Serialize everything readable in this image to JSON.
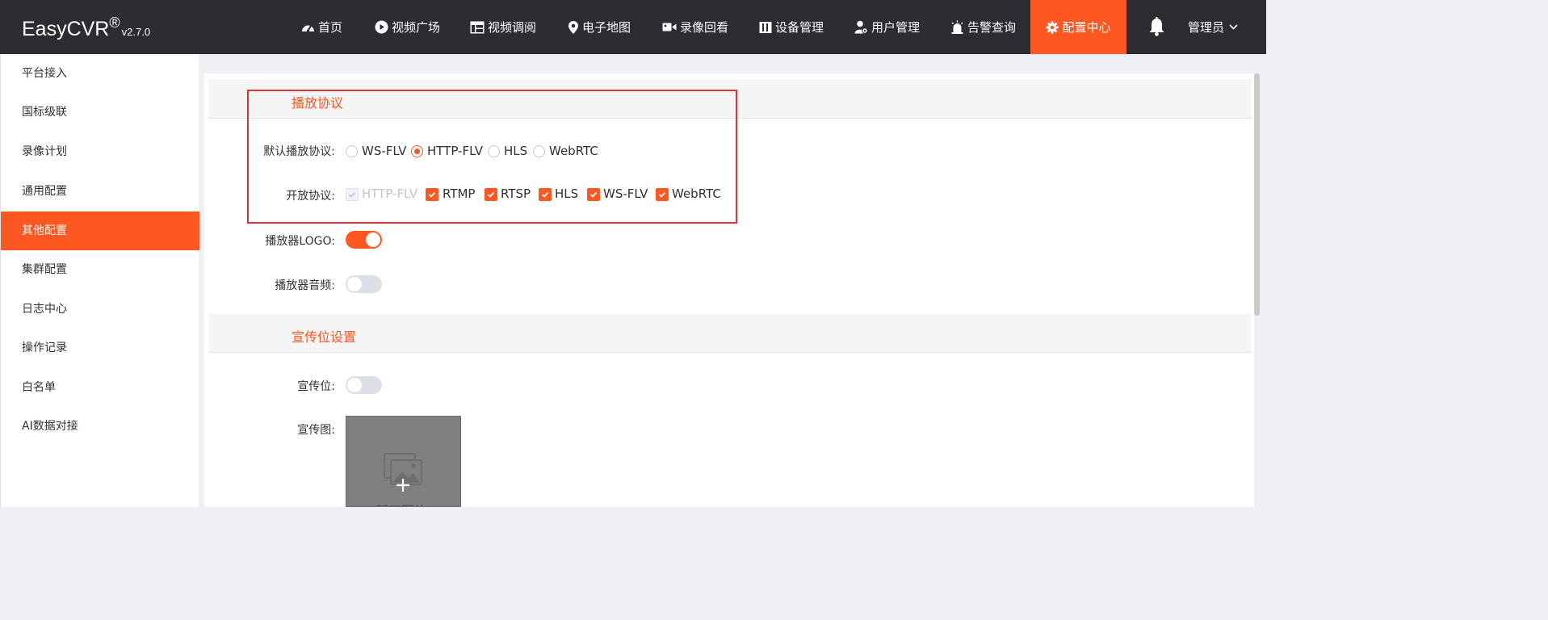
{
  "brand": {
    "name": "EasyCVR",
    "reg": "®",
    "version": "v2.7.0"
  },
  "nav": [
    {
      "label": "首页",
      "icon": "dashboard-icon"
    },
    {
      "label": "视频广场",
      "icon": "play-circle-icon"
    },
    {
      "label": "视频调阅",
      "icon": "grid-layout-icon"
    },
    {
      "label": "电子地图",
      "icon": "map-pin-icon"
    },
    {
      "label": "录像回看",
      "icon": "video-camera-icon"
    },
    {
      "label": "设备管理",
      "icon": "device-icon"
    },
    {
      "label": "用户管理",
      "icon": "user-gear-icon"
    },
    {
      "label": "告警查询",
      "icon": "alarm-icon"
    },
    {
      "label": "配置中心",
      "icon": "gear-icon",
      "active": true
    }
  ],
  "header": {
    "user": "管理员"
  },
  "sidebar": {
    "items": [
      {
        "label": "平台接入"
      },
      {
        "label": "国标级联"
      },
      {
        "label": "录像计划"
      },
      {
        "label": "通用配置"
      },
      {
        "label": "其他配置",
        "active": true
      },
      {
        "label": "集群配置"
      },
      {
        "label": "日志中心"
      },
      {
        "label": "操作记录"
      },
      {
        "label": "白名单"
      },
      {
        "label": "AI数据对接"
      }
    ]
  },
  "playback": {
    "title": "播放协议",
    "default_label": "默认播放协议:",
    "default_options": [
      "WS-FLV",
      "HTTP-FLV",
      "HLS",
      "WebRTC"
    ],
    "default_selected": "HTTP-FLV",
    "open_label": "开放协议:",
    "open_options": [
      {
        "label": "HTTP-FLV",
        "checked": true,
        "disabled": true
      },
      {
        "label": "RTMP",
        "checked": true
      },
      {
        "label": "RTSP",
        "checked": true
      },
      {
        "label": "HLS",
        "checked": true
      },
      {
        "label": "WS-FLV",
        "checked": true
      },
      {
        "label": "WebRTC",
        "checked": true
      }
    ],
    "logo_label": "播放器LOGO:",
    "logo_on": true,
    "audio_label": "播放器音频:",
    "audio_on": false
  },
  "promo": {
    "title": "宣传位设置",
    "toggle_label": "宣传位:",
    "toggle_on": false,
    "image_label": "宣传图:",
    "image_placeholder": "暂无图片"
  },
  "colors": {
    "accent": "#fe5722",
    "topbar": "#2c2d30",
    "highlight": "#e62e35"
  }
}
